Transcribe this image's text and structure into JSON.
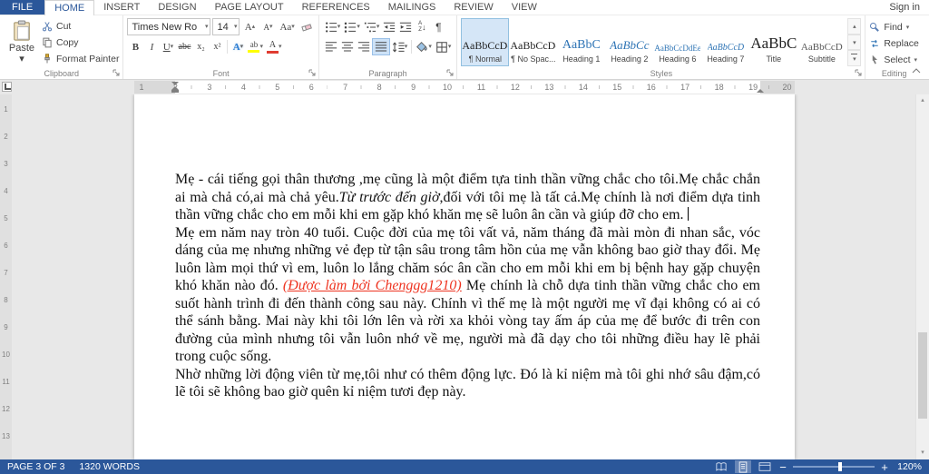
{
  "titlebar": {
    "sign_in": "Sign in"
  },
  "tabs": [
    {
      "label": "FILE",
      "file": true
    },
    {
      "label": "HOME",
      "active": true
    },
    {
      "label": "INSERT"
    },
    {
      "label": "DESIGN"
    },
    {
      "label": "PAGE LAYOUT"
    },
    {
      "label": "REFERENCES"
    },
    {
      "label": "MAILINGS"
    },
    {
      "label": "REVIEW"
    },
    {
      "label": "VIEW"
    }
  ],
  "ribbon": {
    "clipboard": {
      "group_label": "Clipboard",
      "paste": "Paste",
      "cut": "Cut",
      "copy": "Copy",
      "format_painter": "Format Painter"
    },
    "font": {
      "group_label": "Font",
      "font_name": "Times New Ro",
      "font_size": "14"
    },
    "paragraph": {
      "group_label": "Paragraph"
    },
    "styles": {
      "group_label": "Styles",
      "items": [
        {
          "preview": "AaBbCcDc",
          "label": "¶ Normal",
          "cls": "normal",
          "selected": true
        },
        {
          "preview": "AaBbCcDc",
          "label": "¶ No Spac...",
          "cls": "normal"
        },
        {
          "preview": "AaBbC",
          "label": "Heading 1",
          "cls": "h1"
        },
        {
          "preview": "AaBbCc",
          "label": "Heading 2",
          "cls": "h2"
        },
        {
          "preview": "AaBbCcDdEe",
          "label": "Heading 6",
          "cls": "h6"
        },
        {
          "preview": "AaBbCcD",
          "label": "Heading 7",
          "cls": "h7"
        },
        {
          "preview": "AaBbC",
          "label": "Title",
          "cls": "title"
        },
        {
          "preview": "AaBbCcD",
          "label": "Subtitle",
          "cls": "subtitle"
        }
      ]
    },
    "editing": {
      "group_label": "Editing",
      "find": "Find",
      "replace": "Replace",
      "select": "Select"
    }
  },
  "ruler": {
    "h_numbers": [
      "1",
      "2",
      "3",
      "4",
      "5",
      "6",
      "7",
      "8",
      "9",
      "10",
      "11",
      "12",
      "13",
      "14",
      "15",
      "16",
      "17",
      "18",
      "19",
      "20"
    ],
    "v_numbers": [
      "1",
      "2",
      "3",
      "4",
      "5",
      "6",
      "7",
      "8",
      "9",
      "10",
      "11",
      "12",
      "13"
    ]
  },
  "document": {
    "para1": {
      "before": "Mẹ - cái tiếng gọi thân thương ,mẹ cũng là một điểm tựa tinh thần vững chắc cho tôi.Mẹ chắc chắn ai mà chả có,ai mà chả yêu.",
      "italic": "Từ trước đến giờ",
      "after": ",đối với tôi mẹ là tất cả.Mẹ chính là nơi điểm dựa tinh thần vững chắc cho em mỗi khi em gặp khó khăn mẹ sẽ luôn ân cần và giúp đỡ cho em. "
    },
    "para2": {
      "before": "Mẹ em năm nay tròn 40 tuổi. Cuộc đời của mẹ tôi vất vả, năm tháng đã mài mòn đi nhan sắc, vóc dáng của mẹ nhưng những vẻ đẹp từ tận sâu trong tâm hồn của mẹ vẫn không bao giờ thay đổi. Mẹ luôn làm mọi thứ vì em, luôn lo lắng chăm sóc ân cần cho em mỗi khi em bị bệnh hay gặp chuyện khó khăn nào đó. ",
      "credit": "(Được làm bởi Chenggg1210)",
      "after": " Mẹ chính là chỗ dựa tinh thần vững chắc cho em suốt hành trình đi đến thành công sau này. Chính vì thế mẹ là một người mẹ vĩ đại không có ai có thể sánh bằng. Mai này khi tôi lớn lên và rời xa khỏi vòng tay ấm áp của mẹ để bước đi trên con đường của mình nhưng tôi vẫn luôn nhớ về mẹ, người mà đã dạy cho tôi những điều hay lẽ phải trong cuộc sống."
    },
    "para3": {
      "text": "Nhờ những lời động viên từ mẹ,tôi như có thêm động lực. Đó là kỉ niệm mà tôi ghi nhớ sâu đậm,có lẽ tôi sẽ không bao giờ quên kỉ niệm tươi đẹp này."
    }
  },
  "statusbar": {
    "page_info": "PAGE 3 OF 3",
    "word_count": "1320 WORDS",
    "zoom_level": "120%"
  },
  "icons": {
    "caret_down": "▾",
    "caret_up": "▴",
    "pilcrow": "¶",
    "bold": "B",
    "italic": "I",
    "underline": "U",
    "strikethrough": "abc",
    "subscript": "x₂",
    "superscript": "x²",
    "letter_a": "A",
    "letter_z": "Z",
    "letters_aa": "Aa",
    "highlight_ab": "ab",
    "arrow_down": "↓",
    "minus": "−",
    "plus": "+"
  },
  "colors": {
    "theme_blue": "#2b579a",
    "credit_text": "#ee3421",
    "heading_blue": "#2e74b5"
  }
}
